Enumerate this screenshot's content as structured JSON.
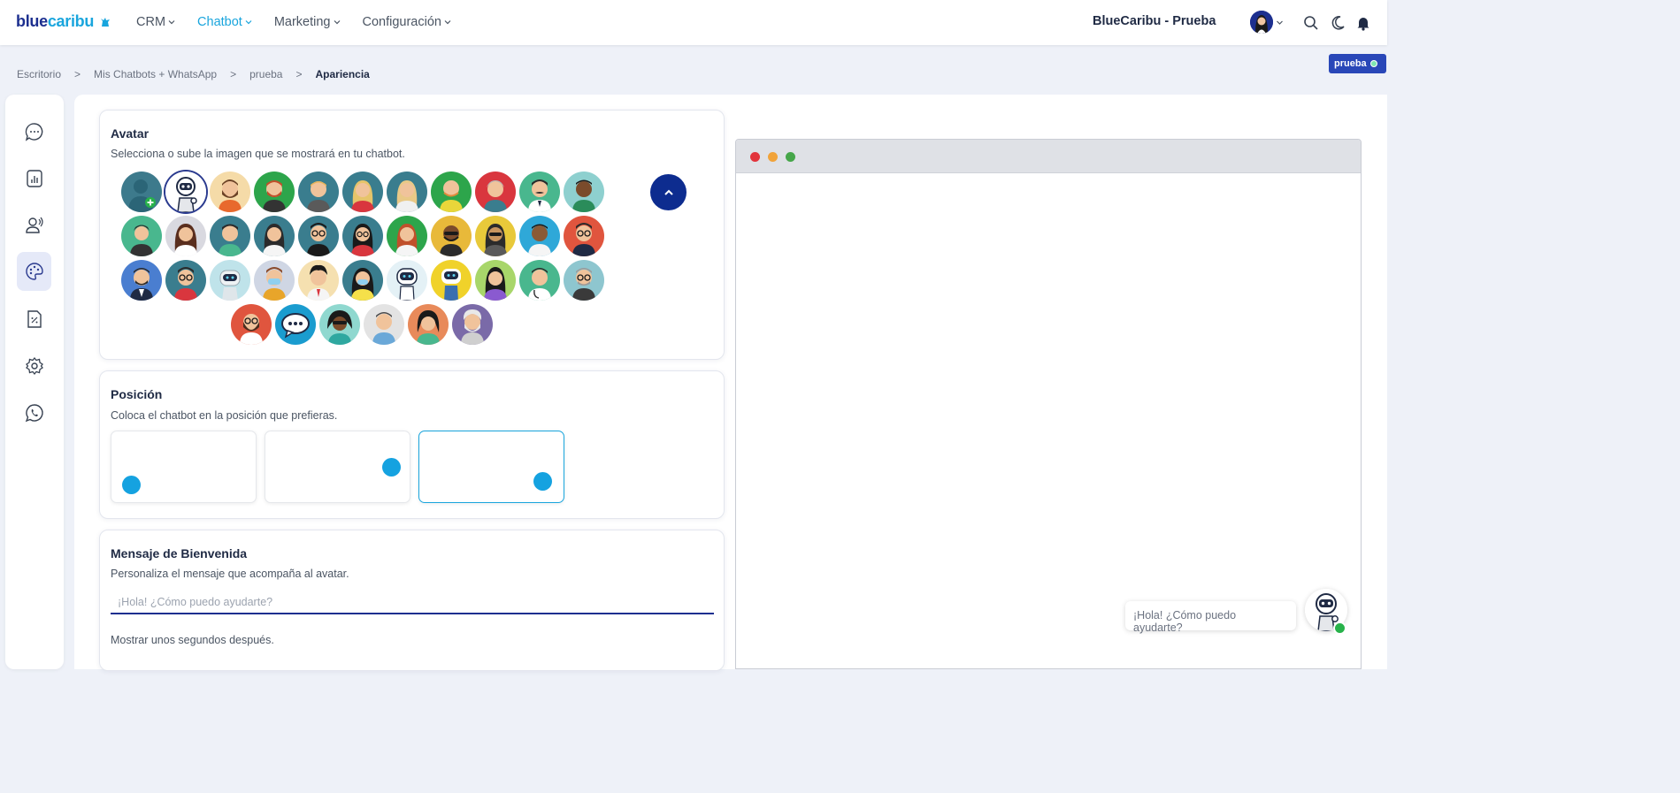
{
  "header": {
    "logo_part1": "blue",
    "logo_part2": "caribu",
    "nav": [
      {
        "label": "CRM",
        "active": false
      },
      {
        "label": "Chatbot",
        "active": true
      },
      {
        "label": "Marketing",
        "active": false
      },
      {
        "label": "Configuración",
        "active": false
      }
    ],
    "company": "BlueCaribu - Prueba",
    "icons": [
      "search-icon",
      "moon-icon",
      "bell-icon"
    ]
  },
  "breadcrumb": [
    "Escritorio",
    "Mis Chatbots + WhatsApp",
    "prueba",
    "Apariencia"
  ],
  "badge": "prueba",
  "sidebar": {
    "items": [
      "chat-bubble-icon",
      "chart-icon",
      "contacts-icon",
      "palette-icon",
      "document-percent-icon",
      "gear-icon",
      "whatsapp-icon"
    ],
    "active_index": 3
  },
  "avatar_card": {
    "title": "Avatar",
    "desc": "Selecciona o sube la imagen que se mostrará en tu chatbot.",
    "selected_index": 1
  },
  "position_card": {
    "title": "Posición",
    "desc": "Coloca el chatbot en la posición que prefieras.",
    "selected_index": 2
  },
  "welcome_card": {
    "title": "Mensaje de Bienvenida",
    "desc": "Personaliza el mensaje que acompaña al avatar.",
    "placeholder": "¡Hola! ¿Cómo puedo ayudarte?",
    "delay_label": "Mostrar unos segundos después."
  },
  "preview": {
    "bubble_text": "¡Hola! ¿Cómo puedo ayudarte?"
  },
  "colors": {
    "brand_dark": "#1c2f8f",
    "brand_cyan": "#19a5dd",
    "dot_red": "#e2343c",
    "dot_orange": "#f1a33a",
    "dot_green": "#46a64a",
    "online_green": "#27b24a"
  }
}
